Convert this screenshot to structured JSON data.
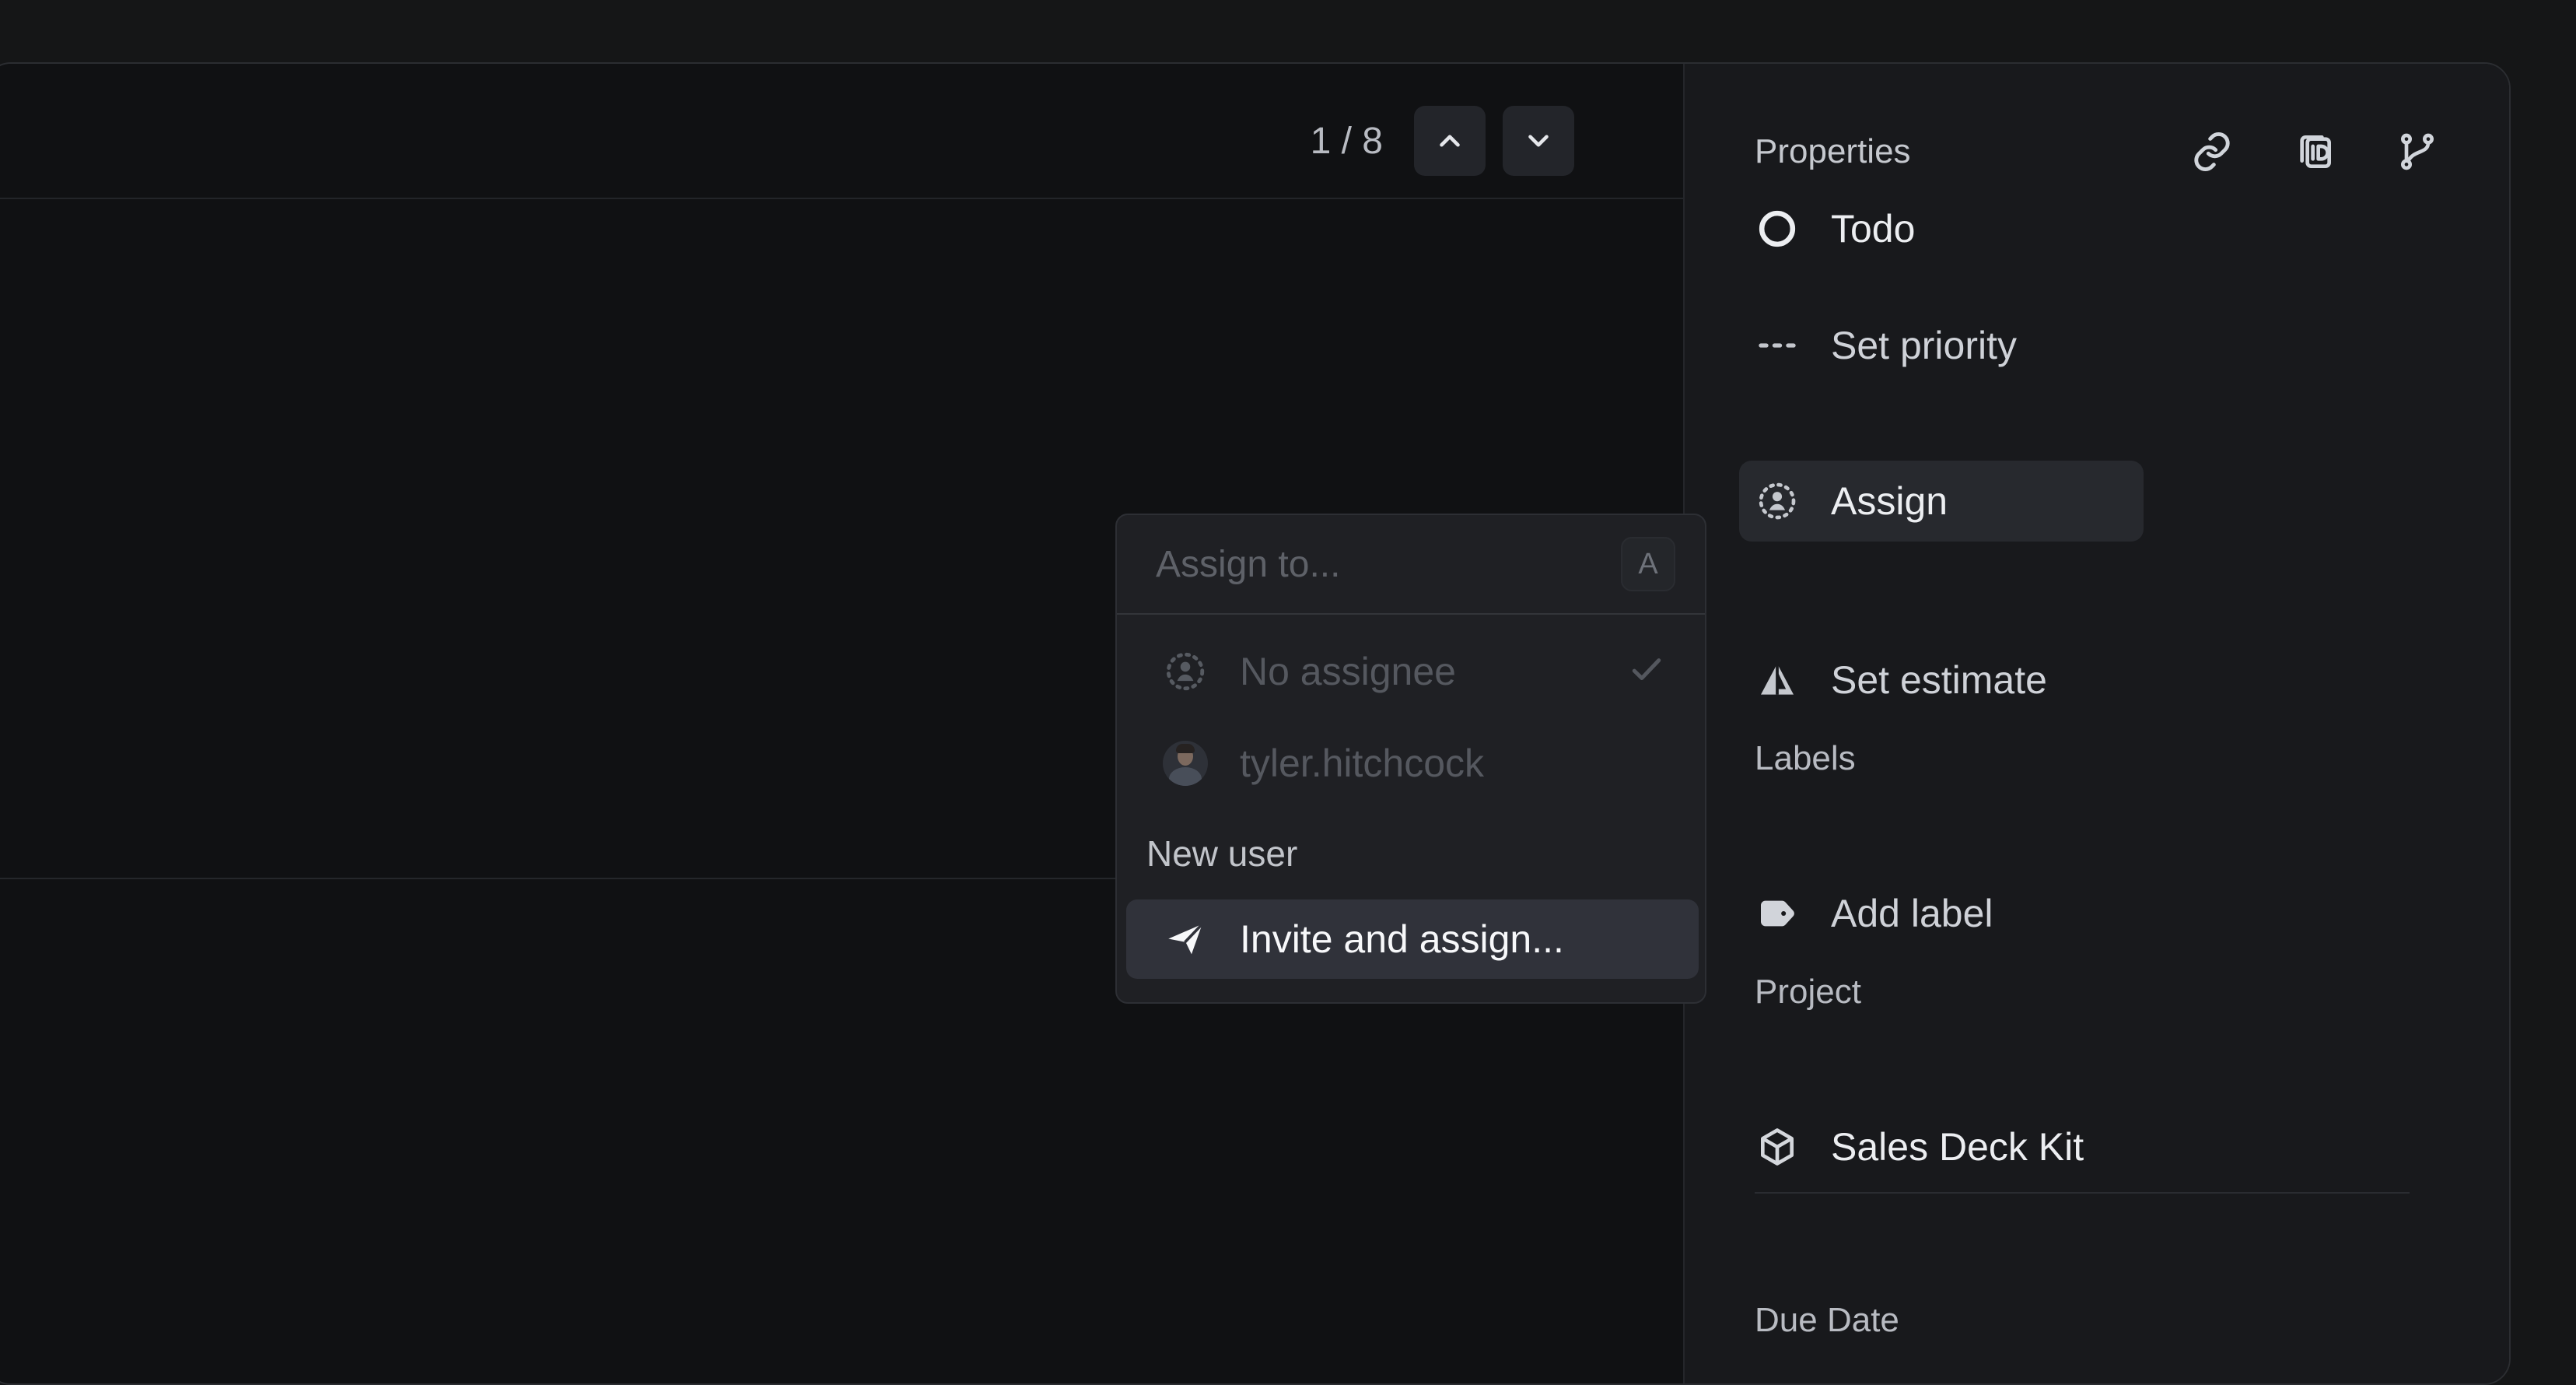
{
  "pager": {
    "count": "1 / 8",
    "previous_icon": "chevron-up-icon",
    "next_icon": "chevron-down-icon"
  },
  "sidebar": {
    "title": "Properties",
    "header_icons": [
      "link-icon",
      "copy-id-icon",
      "branch-icon"
    ],
    "properties": [
      {
        "label": "Todo",
        "icon": "circle-status-icon"
      },
      {
        "label": "Set priority",
        "icon": "dashed-priority-icon"
      },
      {
        "label": "Assign",
        "icon": "assignee-icon",
        "active": true
      },
      {
        "label": "Set estimate",
        "icon": "estimate-triangle-icon"
      }
    ],
    "labels_section": {
      "title": "Labels",
      "add_label": "Add label",
      "icon": "tag-icon"
    },
    "project_section": {
      "title": "Project",
      "value": "Sales Deck Kit",
      "icon": "project-cube-icon"
    },
    "due_date_title": "Due Date"
  },
  "assign_popover": {
    "placeholder": "Assign to...",
    "value": "",
    "shortcut": "A",
    "options": [
      {
        "label": "No assignee",
        "icon": "no-assignee-icon",
        "checked": true
      },
      {
        "label": "tyler.hitchcock",
        "icon": "avatar"
      }
    ],
    "new_user_label": "New user",
    "invite_label": "Invite and assign...",
    "invite_icon": "send-icon"
  },
  "colors": {
    "background": "#151617",
    "main_surface": "#101113",
    "sidebar_surface": "#18191c",
    "popover_surface": "#1f2024",
    "selected_row": "#30323a"
  }
}
